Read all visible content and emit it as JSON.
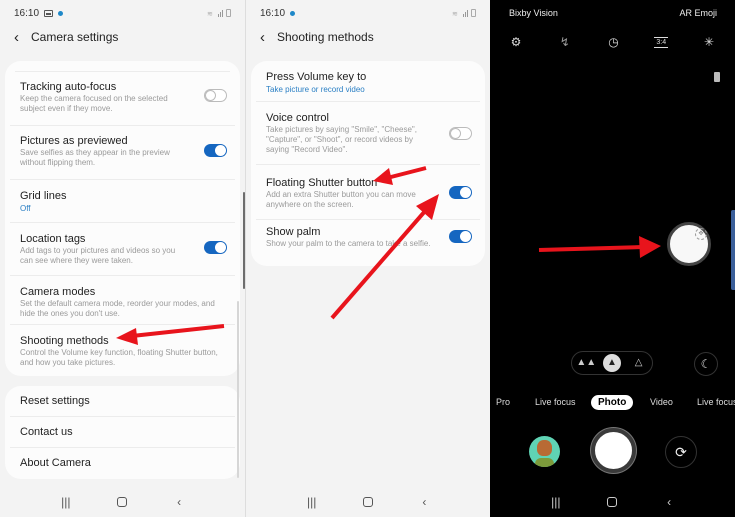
{
  "status_bar": {
    "time": "16:10"
  },
  "camera_settings": {
    "title": "Camera settings",
    "items": [
      {
        "title": "Tracking auto-focus",
        "subtitle": "Keep the camera focused on the selected subject even if they move.",
        "toggle": "off"
      },
      {
        "title": "Pictures as previewed",
        "subtitle": "Save selfies as they appear in the preview without flipping them.",
        "toggle": "on"
      },
      {
        "title": "Grid lines",
        "value": "Off"
      },
      {
        "title": "Location tags",
        "subtitle": "Add tags to your pictures and videos so you can see where they were taken.",
        "toggle": "on"
      },
      {
        "title": "Camera modes",
        "subtitle": "Set the default camera mode, reorder your modes, and hide the ones you don't use."
      },
      {
        "title": "Shooting methods",
        "subtitle": "Control the Volume key function, floating Shutter button, and how you take pictures."
      }
    ],
    "footer_items": [
      {
        "title": "Reset settings"
      },
      {
        "title": "Contact us"
      },
      {
        "title": "About Camera"
      }
    ]
  },
  "shooting_methods": {
    "title": "Shooting methods",
    "items": [
      {
        "title": "Press Volume key to",
        "value": "Take picture or record video"
      },
      {
        "title": "Voice control",
        "subtitle": "Take pictures by saying \"Smile\", \"Cheese\", \"Capture\", or \"Shoot\", or record videos by saying \"Record Video\".",
        "toggle": "off"
      },
      {
        "title": "Floating Shutter button",
        "subtitle": "Add an extra Shutter button you can move anywhere on the screen.",
        "toggle": "on"
      },
      {
        "title": "Show palm",
        "subtitle": "Show your palm to the camera to take a selfie.",
        "toggle": "on"
      }
    ]
  },
  "camera": {
    "top_left": "Bixby Vision",
    "top_right": "AR Emoji",
    "icons": [
      "settings-icon",
      "flash-off-icon",
      "timer-off-icon",
      "aspect-ratio-icon",
      "filter-effects-icon"
    ],
    "ratio_label": "3:4",
    "lens_options": [
      "wide-angle",
      "standard",
      "telephoto"
    ],
    "modes": [
      "Pro",
      "Live focus",
      "Photo",
      "Video",
      "Live focus"
    ],
    "selected_mode": "Photo"
  },
  "nav_buttons": [
    "recent-apps",
    "home",
    "back"
  ],
  "annotation_color": "#e8141c"
}
